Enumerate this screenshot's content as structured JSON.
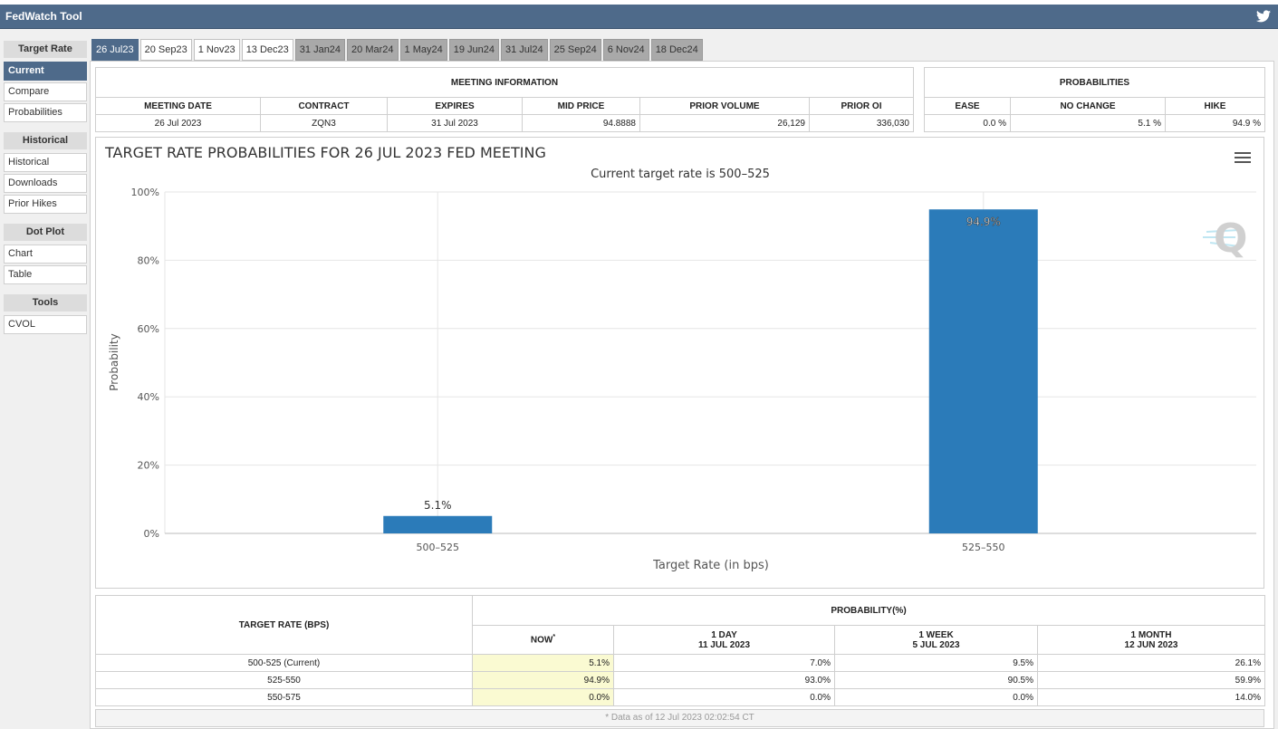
{
  "app": {
    "title": "FedWatch Tool"
  },
  "sidebar": {
    "sections": [
      {
        "header": "Target Rate",
        "items": [
          "Current",
          "Compare",
          "Probabilities"
        ]
      },
      {
        "header": "Historical",
        "items": [
          "Historical",
          "Downloads",
          "Prior Hikes"
        ]
      },
      {
        "header": "Dot Plot",
        "items": [
          "Chart",
          "Table"
        ]
      },
      {
        "header": "Tools",
        "items": [
          "CVOL"
        ]
      }
    ]
  },
  "tabs": [
    "26 Jul23",
    "20 Sep23",
    "1 Nov23",
    "13 Dec23",
    "31 Jan24",
    "20 Mar24",
    "1 May24",
    "19 Jun24",
    "31 Jul24",
    "25 Sep24",
    "6 Nov24",
    "18 Dec24"
  ],
  "meeting_info": {
    "title": "MEETING INFORMATION",
    "headers": [
      "MEETING DATE",
      "CONTRACT",
      "EXPIRES",
      "MID PRICE",
      "PRIOR VOLUME",
      "PRIOR OI"
    ],
    "values": [
      "26 Jul 2023",
      "ZQN3",
      "31 Jul 2023",
      "94.8888",
      "26,129",
      "336,030"
    ]
  },
  "probabilities": {
    "title": "PROBABILITIES",
    "headers": [
      "EASE",
      "NO CHANGE",
      "HIKE"
    ],
    "values": [
      "0.0 %",
      "5.1 %",
      "94.9 %"
    ]
  },
  "chart_data": {
    "type": "bar",
    "title": "TARGET RATE PROBABILITIES FOR 26 JUL 2023 FED MEETING",
    "subtitle": "Current target rate is 500–525",
    "xlabel": "Target Rate (in bps)",
    "ylabel": "Probability",
    "categories": [
      "500–525",
      "525–550"
    ],
    "values": [
      5.1,
      94.9
    ],
    "value_labels": [
      "5.1%",
      "94.9%"
    ],
    "ylim": [
      0,
      100
    ],
    "yticks": [
      "0%",
      "20%",
      "40%",
      "60%",
      "80%",
      "100%"
    ],
    "bar_color": "#2b7bb9",
    "grid": true
  },
  "prob_table": {
    "col_target": "TARGET RATE (BPS)",
    "group_header": "PROBABILITY(%)",
    "now": "NOW",
    "now_mark": "*",
    "cols": [
      {
        "line1": "1 DAY",
        "line2": "11 JUL 2023"
      },
      {
        "line1": "1 WEEK",
        "line2": "5 JUL 2023"
      },
      {
        "line1": "1 MONTH",
        "line2": "12 JUN 2023"
      }
    ],
    "rows": [
      [
        "500-525 (Current)",
        "5.1%",
        "7.0%",
        "9.5%",
        "26.1%"
      ],
      [
        "525-550",
        "94.9%",
        "93.0%",
        "90.5%",
        "59.9%"
      ],
      [
        "550-575",
        "0.0%",
        "0.0%",
        "0.0%",
        "14.0%"
      ]
    ],
    "footnote": "* Data as of 12 Jul 2023 02:02:54 CT"
  },
  "colors": {
    "header": "#4e6a8a",
    "highlight": "#fafad2",
    "bar": "#2b7bb9"
  }
}
